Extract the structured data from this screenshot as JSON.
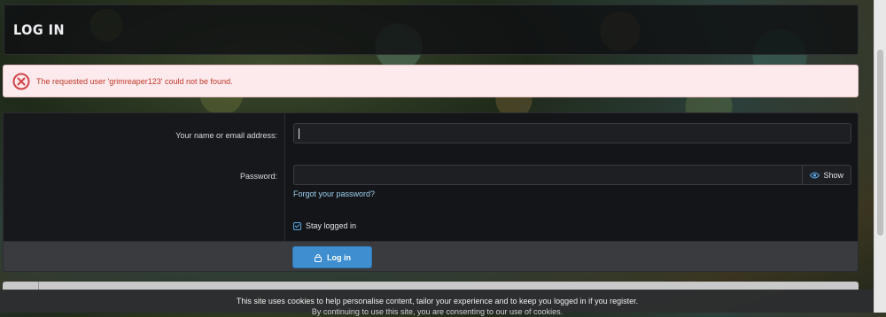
{
  "header": {
    "title": "LOG IN"
  },
  "error": {
    "icon": "error-circle-x-icon",
    "message": "The requested user 'grimreaper123' could not be found.",
    "color": "#c0392b"
  },
  "form": {
    "name_label": "Your name or email address:",
    "name_value": "",
    "password_label": "Password:",
    "password_value": "",
    "show_label": "Show",
    "forgot_link": "Forgot your password?",
    "stay_logged_in_label": "Stay logged in",
    "stay_logged_in_checked": true,
    "submit_label": "Log in",
    "accent_color": "#3e8ed0"
  },
  "cookie_notice": {
    "line1": "This site uses cookies to help personalise content, tailor your experience and to keep you logged in if you register.",
    "line2": "By continuing to use this site, you are consenting to our use of cookies."
  }
}
